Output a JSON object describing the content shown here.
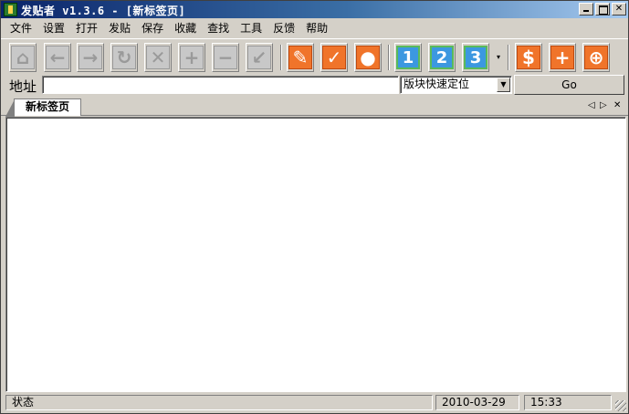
{
  "window": {
    "title": "发贴者 v1.3.6 - [新标签页]"
  },
  "menu": [
    "文件",
    "设置",
    "打开",
    "发贴",
    "保存",
    "收藏",
    "查找",
    "工具",
    "反馈",
    "帮助"
  ],
  "toolbar": {
    "buttons": [
      {
        "name": "home-icon",
        "glyph": "⌂"
      },
      {
        "name": "back-arrow-icon",
        "glyph": "←"
      },
      {
        "name": "forward-arrow-icon",
        "glyph": "→"
      },
      {
        "name": "refresh-icon",
        "glyph": "↻"
      },
      {
        "name": "stop-icon",
        "glyph": "✕"
      },
      {
        "name": "zoom-in-plus-icon",
        "glyph": "+"
      },
      {
        "name": "zoom-out-minus-icon",
        "glyph": "−"
      },
      {
        "name": "restore-arrow-icon",
        "glyph": "↙"
      },
      {
        "name": "pen-icon",
        "glyph": "✎"
      },
      {
        "name": "check-icon",
        "glyph": "✓"
      },
      {
        "name": "user-icon",
        "glyph": "●"
      },
      {
        "name": "slot-1-button",
        "glyph": "1"
      },
      {
        "name": "slot-2-button",
        "glyph": "2"
      },
      {
        "name": "slot-3-button",
        "glyph": "3"
      },
      {
        "name": "dollar-icon",
        "glyph": "$"
      },
      {
        "name": "add-icon",
        "glyph": "+"
      },
      {
        "name": "search-zoom-icon",
        "glyph": "⊕"
      }
    ],
    "dropdown_glyph": "▾"
  },
  "address": {
    "label": "地址",
    "value": "",
    "quick_select": "版块快速定位",
    "select_arrow": "▼",
    "go_label": "Go"
  },
  "tabs": [
    {
      "label": "新标签页"
    }
  ],
  "tab_nav": {
    "prev": "◁",
    "next": "▷",
    "close": "✕"
  },
  "status": {
    "label": "状态",
    "date": "2010-03-29",
    "time": "15:33"
  },
  "colors": {
    "titlebar_start": "#0a246a",
    "titlebar_end": "#a6caf0",
    "orange_icon": "#f0742a",
    "blue_icon": "#3c98e0",
    "face": "#d4d0c8"
  }
}
